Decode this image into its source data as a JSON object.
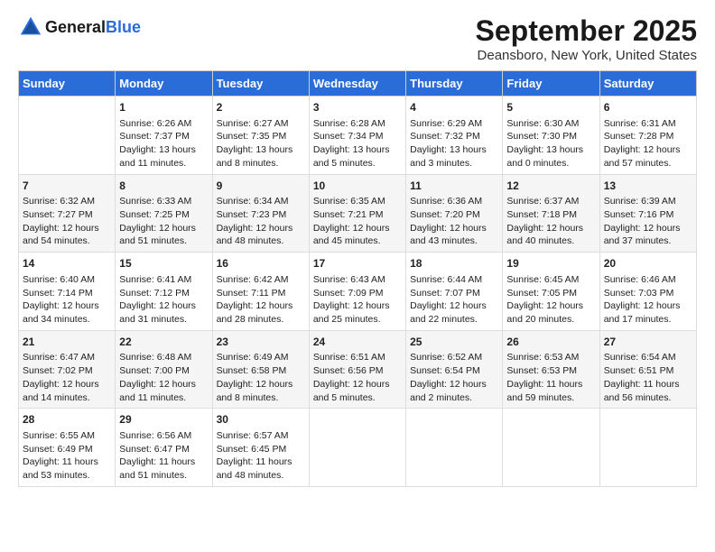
{
  "logo": {
    "general": "General",
    "blue": "Blue"
  },
  "title": "September 2025",
  "subtitle": "Deansboro, New York, United States",
  "days_of_week": [
    "Sunday",
    "Monday",
    "Tuesday",
    "Wednesday",
    "Thursday",
    "Friday",
    "Saturday"
  ],
  "weeks": [
    [
      {
        "day": "",
        "info": ""
      },
      {
        "day": "1",
        "info": "Sunrise: 6:26 AM\nSunset: 7:37 PM\nDaylight: 13 hours\nand 11 minutes."
      },
      {
        "day": "2",
        "info": "Sunrise: 6:27 AM\nSunset: 7:35 PM\nDaylight: 13 hours\nand 8 minutes."
      },
      {
        "day": "3",
        "info": "Sunrise: 6:28 AM\nSunset: 7:34 PM\nDaylight: 13 hours\nand 5 minutes."
      },
      {
        "day": "4",
        "info": "Sunrise: 6:29 AM\nSunset: 7:32 PM\nDaylight: 13 hours\nand 3 minutes."
      },
      {
        "day": "5",
        "info": "Sunrise: 6:30 AM\nSunset: 7:30 PM\nDaylight: 13 hours\nand 0 minutes."
      },
      {
        "day": "6",
        "info": "Sunrise: 6:31 AM\nSunset: 7:28 PM\nDaylight: 12 hours\nand 57 minutes."
      }
    ],
    [
      {
        "day": "7",
        "info": "Sunrise: 6:32 AM\nSunset: 7:27 PM\nDaylight: 12 hours\nand 54 minutes."
      },
      {
        "day": "8",
        "info": "Sunrise: 6:33 AM\nSunset: 7:25 PM\nDaylight: 12 hours\nand 51 minutes."
      },
      {
        "day": "9",
        "info": "Sunrise: 6:34 AM\nSunset: 7:23 PM\nDaylight: 12 hours\nand 48 minutes."
      },
      {
        "day": "10",
        "info": "Sunrise: 6:35 AM\nSunset: 7:21 PM\nDaylight: 12 hours\nand 45 minutes."
      },
      {
        "day": "11",
        "info": "Sunrise: 6:36 AM\nSunset: 7:20 PM\nDaylight: 12 hours\nand 43 minutes."
      },
      {
        "day": "12",
        "info": "Sunrise: 6:37 AM\nSunset: 7:18 PM\nDaylight: 12 hours\nand 40 minutes."
      },
      {
        "day": "13",
        "info": "Sunrise: 6:39 AM\nSunset: 7:16 PM\nDaylight: 12 hours\nand 37 minutes."
      }
    ],
    [
      {
        "day": "14",
        "info": "Sunrise: 6:40 AM\nSunset: 7:14 PM\nDaylight: 12 hours\nand 34 minutes."
      },
      {
        "day": "15",
        "info": "Sunrise: 6:41 AM\nSunset: 7:12 PM\nDaylight: 12 hours\nand 31 minutes."
      },
      {
        "day": "16",
        "info": "Sunrise: 6:42 AM\nSunset: 7:11 PM\nDaylight: 12 hours\nand 28 minutes."
      },
      {
        "day": "17",
        "info": "Sunrise: 6:43 AM\nSunset: 7:09 PM\nDaylight: 12 hours\nand 25 minutes."
      },
      {
        "day": "18",
        "info": "Sunrise: 6:44 AM\nSunset: 7:07 PM\nDaylight: 12 hours\nand 22 minutes."
      },
      {
        "day": "19",
        "info": "Sunrise: 6:45 AM\nSunset: 7:05 PM\nDaylight: 12 hours\nand 20 minutes."
      },
      {
        "day": "20",
        "info": "Sunrise: 6:46 AM\nSunset: 7:03 PM\nDaylight: 12 hours\nand 17 minutes."
      }
    ],
    [
      {
        "day": "21",
        "info": "Sunrise: 6:47 AM\nSunset: 7:02 PM\nDaylight: 12 hours\nand 14 minutes."
      },
      {
        "day": "22",
        "info": "Sunrise: 6:48 AM\nSunset: 7:00 PM\nDaylight: 12 hours\nand 11 minutes."
      },
      {
        "day": "23",
        "info": "Sunrise: 6:49 AM\nSunset: 6:58 PM\nDaylight: 12 hours\nand 8 minutes."
      },
      {
        "day": "24",
        "info": "Sunrise: 6:51 AM\nSunset: 6:56 PM\nDaylight: 12 hours\nand 5 minutes."
      },
      {
        "day": "25",
        "info": "Sunrise: 6:52 AM\nSunset: 6:54 PM\nDaylight: 12 hours\nand 2 minutes."
      },
      {
        "day": "26",
        "info": "Sunrise: 6:53 AM\nSunset: 6:53 PM\nDaylight: 11 hours\nand 59 minutes."
      },
      {
        "day": "27",
        "info": "Sunrise: 6:54 AM\nSunset: 6:51 PM\nDaylight: 11 hours\nand 56 minutes."
      }
    ],
    [
      {
        "day": "28",
        "info": "Sunrise: 6:55 AM\nSunset: 6:49 PM\nDaylight: 11 hours\nand 53 minutes."
      },
      {
        "day": "29",
        "info": "Sunrise: 6:56 AM\nSunset: 6:47 PM\nDaylight: 11 hours\nand 51 minutes."
      },
      {
        "day": "30",
        "info": "Sunrise: 6:57 AM\nSunset: 6:45 PM\nDaylight: 11 hours\nand 48 minutes."
      },
      {
        "day": "",
        "info": ""
      },
      {
        "day": "",
        "info": ""
      },
      {
        "day": "",
        "info": ""
      },
      {
        "day": "",
        "info": ""
      }
    ]
  ]
}
